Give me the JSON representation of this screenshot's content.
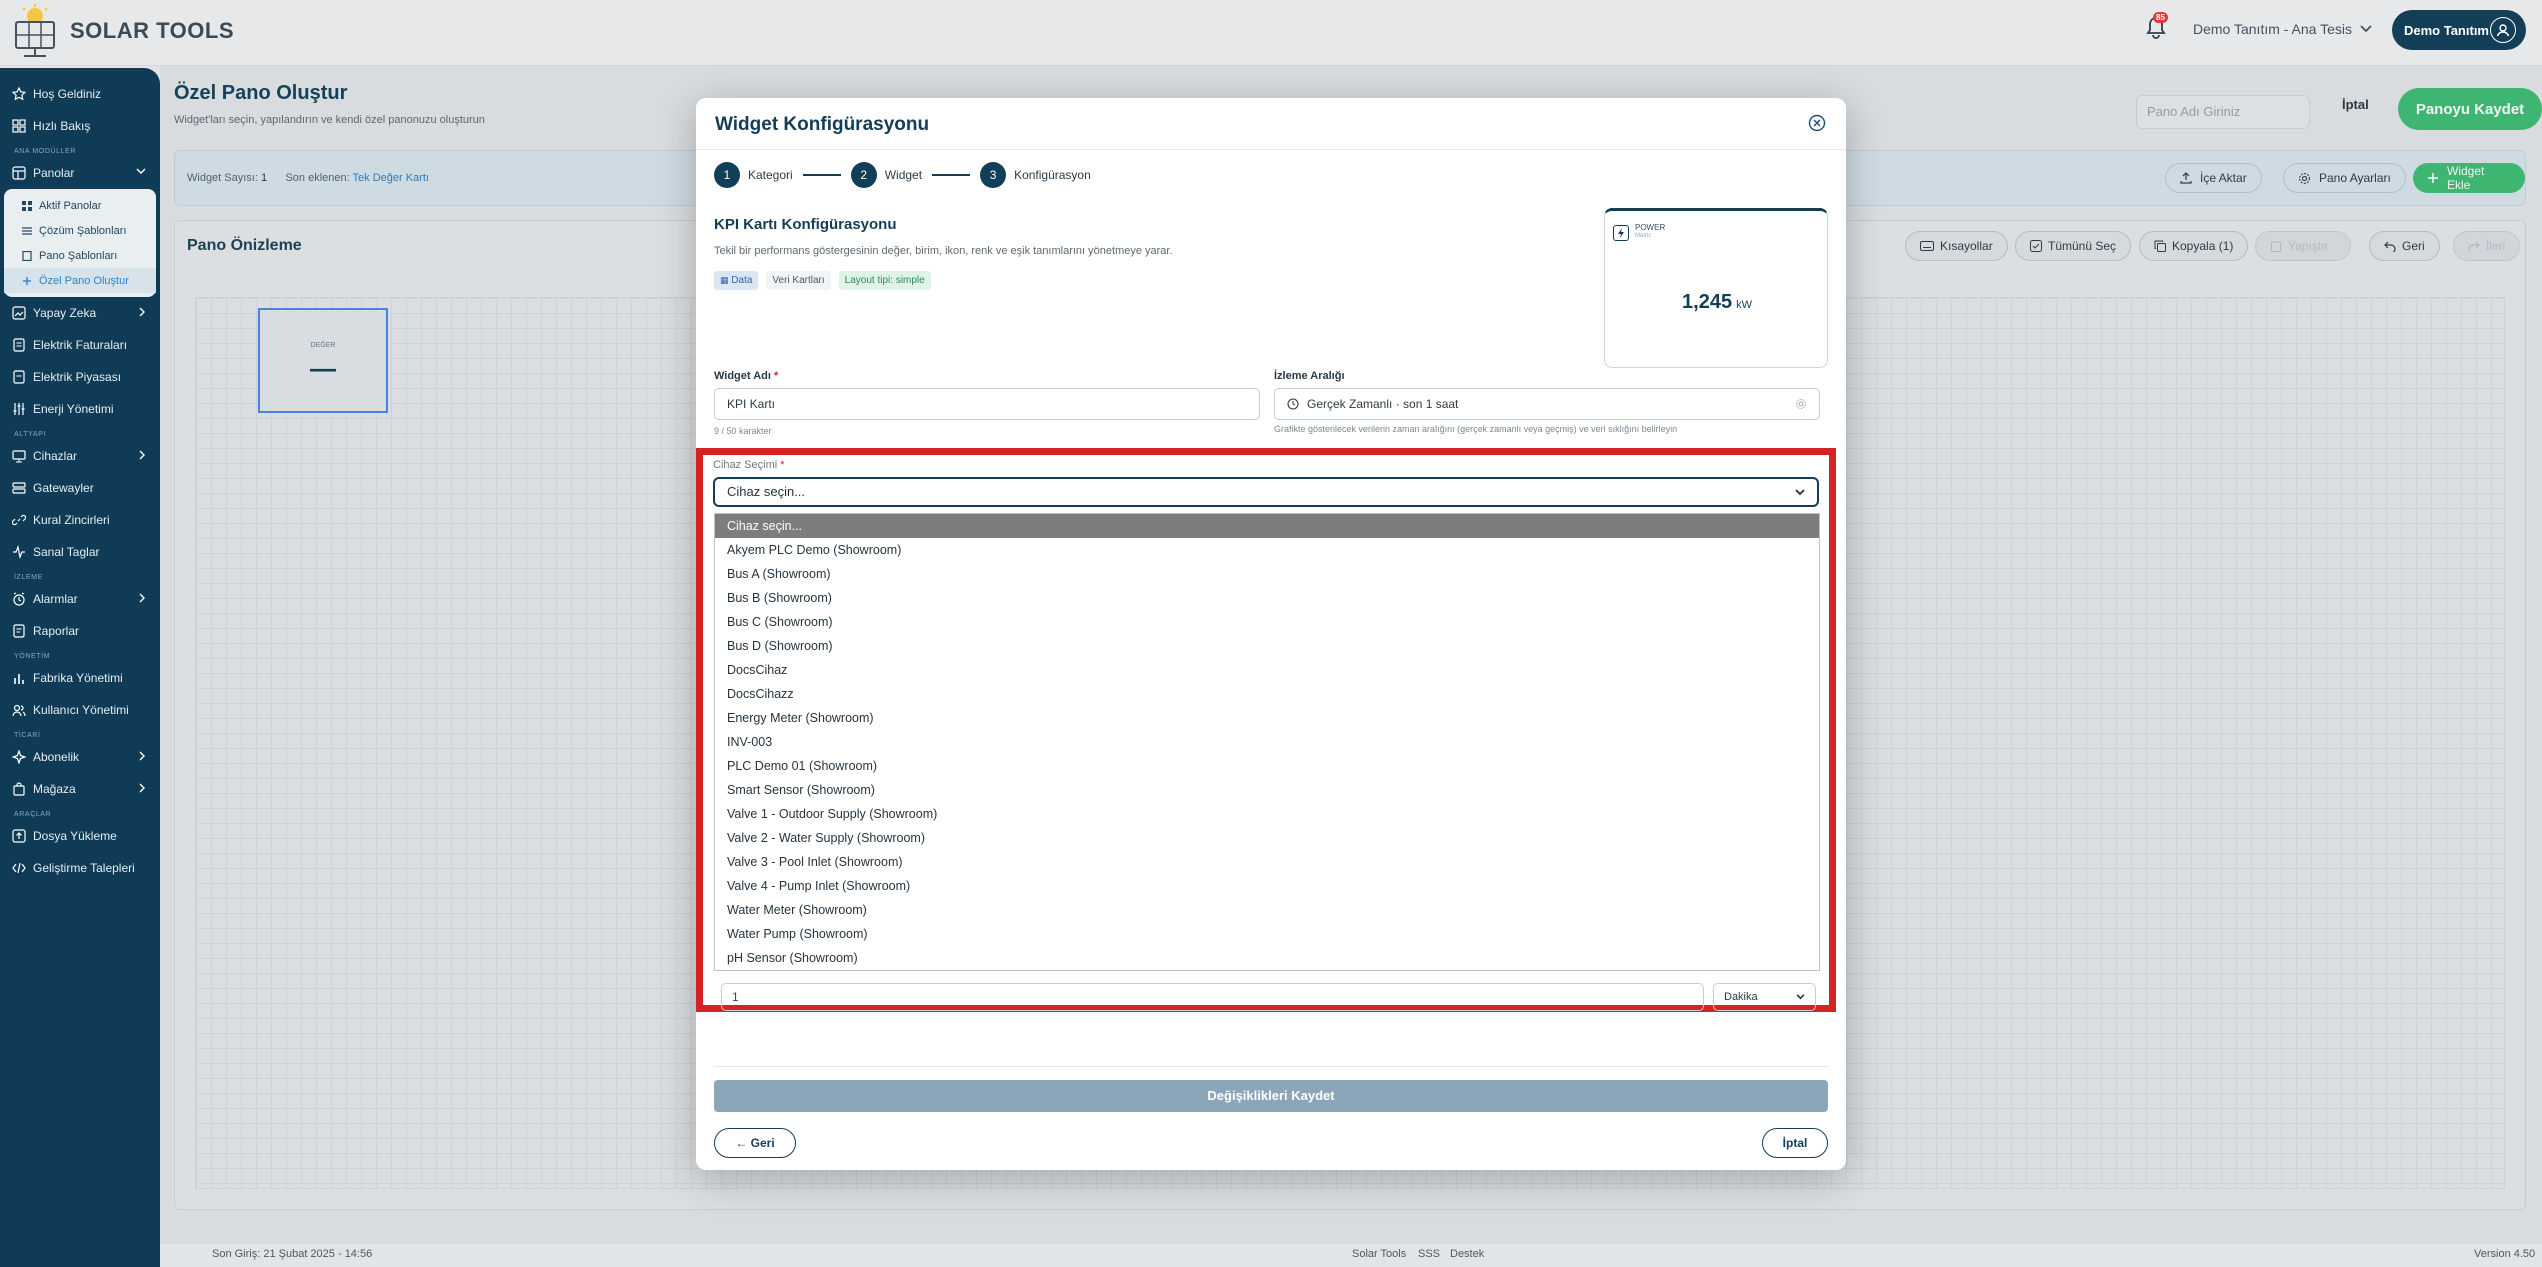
{
  "app": {
    "brand": "SOLAR TOOLS",
    "tenant": "Demo Tanıtım - Ana Tesis",
    "user": "Demo Tanıtım",
    "notifications": "85"
  },
  "sidebar": {
    "welcome": "Hoş Geldiniz",
    "quick": "Hızlı Bakış",
    "sec_main": "ANA MODÜLLER",
    "panolar": "Panolar",
    "sub": [
      "Aktif Panolar",
      "Çözüm Şablonları",
      "Pano Şablonları",
      "Özel Pano Oluştur"
    ],
    "ai": "Yapay Zeka",
    "bills": "Elektrik Faturaları",
    "market": "Elektrik Piyasası",
    "energy": "Enerji Yönetimi",
    "sec_infra": "ALTYAPI",
    "devices": "Cihazlar",
    "gateways": "Gatewayler",
    "rules": "Kural Zincirleri",
    "virtual": "Sanal Taglar",
    "sec_monitor": "İZLEME",
    "alarms": "Alarmlar",
    "reports": "Raporlar",
    "sec_admin": "YÖNETİM",
    "factory": "Fabrika Yönetimi",
    "users": "Kullanıcı Yönetimi",
    "sec_commerce": "TİCARİ",
    "subscription": "Abonelik",
    "store": "Mağaza",
    "sec_tools": "ARAÇLAR",
    "upload": "Dosya Yükleme",
    "dev_requests": "Geliştirme Talepleri"
  },
  "header": {
    "title": "Özel Pano Oluştur",
    "subtitle": "Widget'ları seçin, yapılandırın ve kendi özel panonuzu oluşturun",
    "pano_placeholder": "Pano Adı Giriniz",
    "cancel": "İptal",
    "save": "Panoyu Kaydet"
  },
  "infobar": {
    "widget_count_label": "Widget Sayısı:",
    "widget_count": "1",
    "last_added_label": "Son eklenen:",
    "last_added": "Tek Değer Kartı",
    "import": "İçe Aktar",
    "settings": "Pano Ayarları",
    "add": "Widget Ekle"
  },
  "preview": {
    "title": "Pano Önizleme",
    "shortcuts": "Kısayollar",
    "select_all": "Tümünü Seç",
    "copy": "Kopyala (1)",
    "paste": "Yapıştır",
    "undo": "Geri",
    "redo": "İleri",
    "kpi_label": "DEĞER",
    "kpi_value": "—"
  },
  "modal": {
    "title": "Widget Konfigürasyonu",
    "steps": [
      {
        "n": "1",
        "label": "Kategori"
      },
      {
        "n": "2",
        "label": "Widget"
      },
      {
        "n": "3",
        "label": "Konfigürasyon"
      }
    ],
    "cfg_title": "KPI Kartı Konfigürasyonu",
    "cfg_desc": "Tekil bir performans göstergesinin değer, birim, ikon, renk ve eşik tanımlarını yönetmeye yarar.",
    "tags": [
      "Data",
      "Veri Kartları",
      "Layout tipi: simple"
    ],
    "preview": {
      "label": "POWER",
      "sub": "Metric",
      "value": "1,245",
      "unit": "kW"
    },
    "widget_name_label": "Widget Adı",
    "widget_name": "KPI Kartı",
    "char_count": "9 / 50 karakter",
    "range_label": "İzleme Aralığı",
    "range_value": "Gerçek Zamanlı · son 1 saat",
    "range_help": "Grafikte gösterilecek verilerin zaman aralığını (gerçek zamanlı veya geçmiş) ve veri sıklığını belirleyin",
    "device_label": "Cihaz Seçimi",
    "device_value": "Cihaz seçin...",
    "options": [
      "Cihaz seçin...",
      "Akyem PLC Demo (Showroom)",
      "Bus A (Showroom)",
      "Bus B (Showroom)",
      "Bus C (Showroom)",
      "Bus D (Showroom)",
      "DocsCihaz",
      "DocsCihazz",
      "Energy Meter (Showroom)",
      "INV-003",
      "PLC Demo 01 (Showroom)",
      "Smart Sensor (Showroom)",
      "Valve 1 - Outdoor Supply (Showroom)",
      "Valve 2 - Water Supply (Showroom)",
      "Valve 3 - Pool Inlet (Showroom)",
      "Valve 4 - Pump Inlet (Showroom)",
      "Water Meter (Showroom)",
      "Water Pump (Showroom)",
      "pH Sensor (Showroom)"
    ],
    "interval_value": "1",
    "interval_unit": "Dakika",
    "save_changes": "Değişiklikleri Kaydet",
    "back": "← Geri",
    "cancel": "İptal"
  },
  "footer": {
    "last_login": "Son Giriş: 21 Şubat 2025 - 14:56",
    "brand": "Solar Tools",
    "faq": "SSS",
    "support": "Destek",
    "version": "Version 4.50"
  },
  "colors": {
    "primary": "#123e58",
    "green": "#3fbc74",
    "red_highlight": "#d42323",
    "link": "#2c7fbf"
  }
}
